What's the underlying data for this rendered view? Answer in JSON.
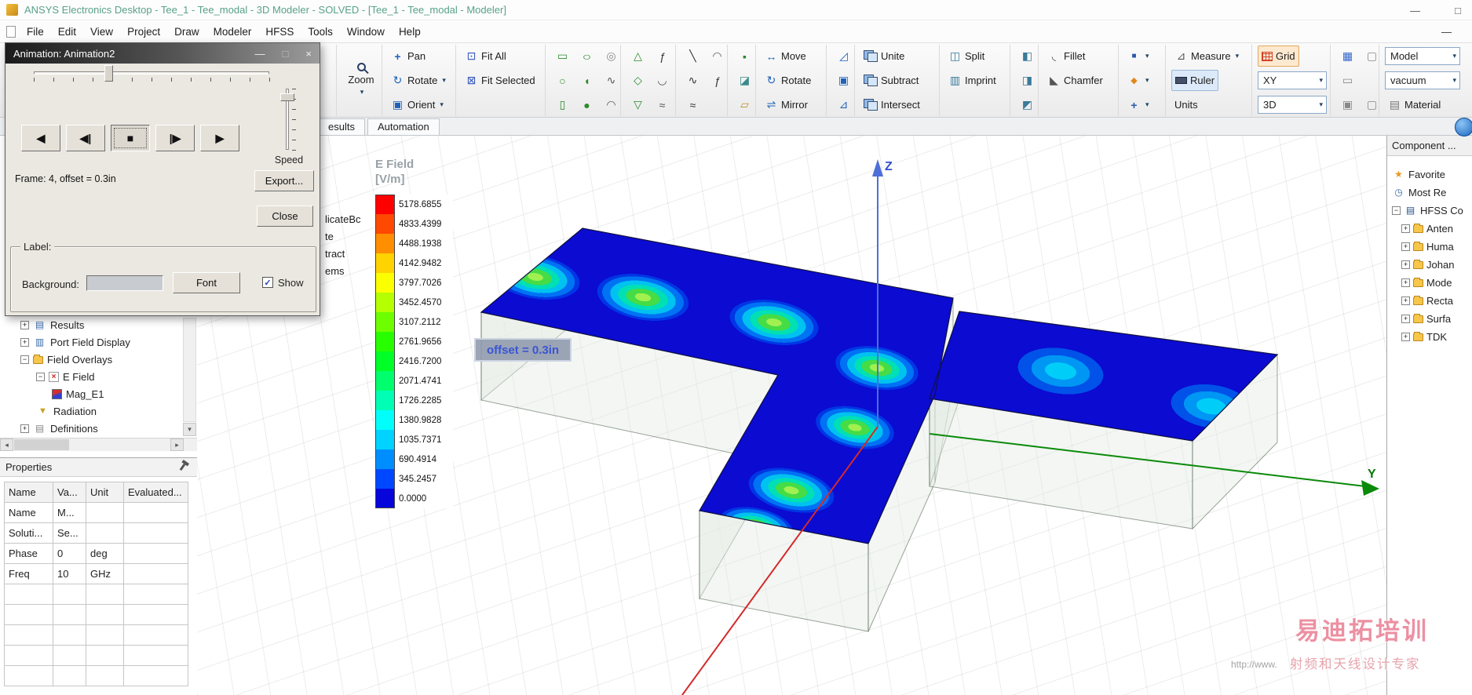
{
  "window": {
    "title": "ANSYS Electronics Desktop - Tee_1 - Tee_modal - 3D Modeler - SOLVED - [Tee_1 - Tee_modal - Modeler]",
    "minimize": "—",
    "restore": "□",
    "mdi_minimize": "—"
  },
  "menu": {
    "items": [
      "File",
      "Edit",
      "View",
      "Project",
      "Draw",
      "Modeler",
      "HFSS",
      "Tools",
      "Window",
      "Help"
    ]
  },
  "tabs": {
    "items": [
      "esults",
      "Automation"
    ]
  },
  "clipped_labels": [
    "licateBc",
    "te",
    "tract",
    "ems"
  ],
  "toolbar": {
    "zoom": "Zoom",
    "pan": "Pan",
    "rotate_view": "Rotate",
    "orient": "Orient",
    "fit_all": "Fit All",
    "fit_selected": "Fit Selected",
    "move": "Move",
    "rotate": "Rotate",
    "mirror": "Mirror",
    "unite": "Unite",
    "subtract": "Subtract",
    "intersect": "Intersect",
    "split": "Split",
    "imprint": "Imprint",
    "fillet": "Fillet",
    "chamfer": "Chamfer",
    "measure": "Measure",
    "ruler": "Ruler",
    "units": "Units",
    "grid": "Grid",
    "plane": "XY",
    "dimension": "3D",
    "model": "Model",
    "material_value": "vacuum",
    "material": "Material"
  },
  "dialog": {
    "title": "Animation: Animation2",
    "minimize": "—",
    "maximize": "□",
    "close_x": "×",
    "play_buttons": [
      "◀",
      "◀|",
      "■",
      "|▶",
      "▶"
    ],
    "speed": "Speed",
    "frame_info": "Frame: 4, offset = 0.3in",
    "export": "Export...",
    "close": "Close",
    "label_group": "Label:",
    "background": "Background:",
    "font": "Font",
    "show": "Show",
    "show_checked": "✓"
  },
  "project_tree": {
    "items": [
      {
        "label": "Results",
        "expand": "+"
      },
      {
        "label": "Port Field Display",
        "expand": "+"
      },
      {
        "label": "Field Overlays",
        "expand": "−"
      },
      {
        "label": "E Field",
        "expand": "−"
      },
      {
        "label": "Mag_E1",
        "expand": ""
      },
      {
        "label": "Radiation",
        "expand": ""
      },
      {
        "label": "Definitions",
        "expand": "+"
      }
    ]
  },
  "properties_panel": {
    "title": "Properties",
    "columns": [
      "Name",
      "Va...",
      "Unit",
      "Evaluated..."
    ],
    "rows": [
      [
        "Name",
        "M...",
        "",
        ""
      ],
      [
        "Soluti...",
        "Se...",
        "",
        ""
      ],
      [
        "Phase",
        "0",
        "deg",
        ""
      ],
      [
        "Freq",
        "10",
        "GHz",
        ""
      ]
    ]
  },
  "legend": {
    "title1": "E Field",
    "title2": "[V/m]",
    "values": [
      "5178.6855",
      "4833.4399",
      "4488.1938",
      "4142.9482",
      "3797.7026",
      "3452.4570",
      "3107.2112",
      "2761.9656",
      "2416.7200",
      "2071.4741",
      "1726.2285",
      "1380.9828",
      "1035.7371",
      "690.4914",
      "345.2457",
      "0.0000"
    ],
    "colors": [
      "#ff0000",
      "#ff4800",
      "#ff8e00",
      "#ffd300",
      "#fbff00",
      "#b4ff00",
      "#6dff00",
      "#27ff00",
      "#00ff27",
      "#00ff6d",
      "#00ffb4",
      "#00fffb",
      "#00d3ff",
      "#008eff",
      "#0048ff",
      "#0505dc"
    ]
  },
  "viewport": {
    "offset_label": "offset = 0.3in",
    "axis_y": "Y",
    "axis_z": "Z",
    "axis_colors": {
      "x": "#d42a2a",
      "y": "#0a8a0a",
      "z": "#4f6fd8"
    },
    "field_base_color": "#0b0bd2"
  },
  "component_panel": {
    "title": "Component ...",
    "items": [
      {
        "label": "Favorite",
        "expand": ""
      },
      {
        "label": "Most Re",
        "expand": ""
      },
      {
        "label": "HFSS Co",
        "expand": "−"
      },
      {
        "label": "Anten",
        "expand": "+"
      },
      {
        "label": "Huma",
        "expand": "+"
      },
      {
        "label": "Johan",
        "expand": "+"
      },
      {
        "label": "Mode",
        "expand": "+"
      },
      {
        "label": "Recta",
        "expand": "+"
      },
      {
        "label": "Surfa",
        "expand": "+"
      },
      {
        "label": "TDK",
        "expand": "+"
      }
    ]
  },
  "watermark": {
    "line1": "易迪拓培训",
    "line2": "射频和天线设计专家",
    "line3": "http://www."
  },
  "icons": {
    "chevron_down": "▾",
    "pan": "+",
    "rotate": "↻",
    "orient": "▣",
    "fit_all": "⊡",
    "fit_selected": "⊠",
    "rectangle": "▭",
    "ellipse": "○",
    "spiral": "◎",
    "circle": "○",
    "segment": "◖",
    "spline": "∿",
    "cylinder": "▯",
    "sphere": "●",
    "arc": "◠",
    "triangle": "△",
    "equation": "ƒ",
    "rhombus": "◇",
    "arc2": "◡",
    "cone": "▽",
    "wave": "≈",
    "line": "╲",
    "point": "▪",
    "face": "◪",
    "plane": "▱",
    "move": "↔",
    "mirror": "⇌",
    "scale": "◿",
    "offset": "▣",
    "wedge": "⊿",
    "split": "◫",
    "imprint": "▥",
    "section1": "◧",
    "section2": "◨",
    "section3": "◩",
    "fillet": "◟",
    "chamfer": "◣",
    "cube": "■",
    "diamond": "◆",
    "cross": "+",
    "measure": "⊿",
    "material": "▤",
    "grid_snap": "▦",
    "box": "▢",
    "bar": "▭",
    "star": "★",
    "clock": "◷",
    "stack": "▤",
    "funnel": "▼",
    "chart": "▤",
    "monitor": "▥",
    "left": "◂",
    "right": "▸",
    "down": "▾"
  }
}
